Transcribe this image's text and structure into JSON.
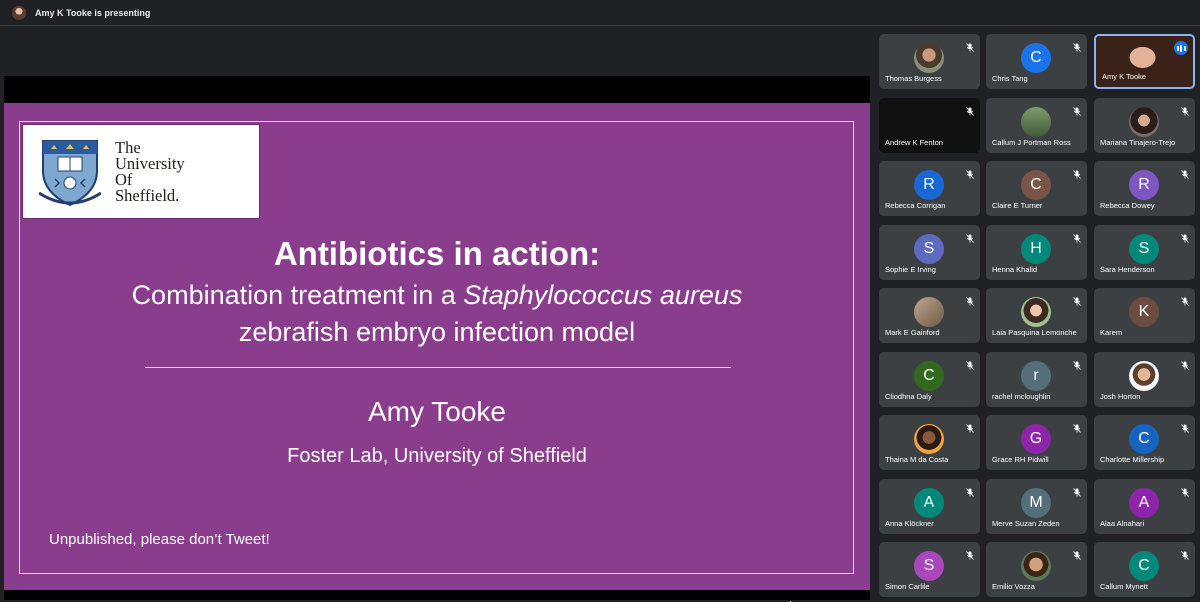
{
  "topbar": {
    "presenting_text": "Amy K Tooke is presenting"
  },
  "slide": {
    "logo_lines": [
      "The",
      "University",
      "Of",
      "Sheffield."
    ],
    "title": "Antibiotics in action:",
    "subtitle_pre": "Combination treatment in a ",
    "subtitle_italic": "Staphylococcus aureus",
    "subtitle_line2": "zebrafish embryo infection model",
    "presenter": "Amy Tooke",
    "affiliation": "Foster Lab, University of Sheffield",
    "disclaimer": "Unpublished, please don’t Tweet!"
  },
  "participants": [
    {
      "name": "Thomas Burgess",
      "type": "photo",
      "muted": true
    },
    {
      "name": "Chris Tang",
      "type": "initial",
      "initial": "C",
      "color": "#1a73e8",
      "muted": true
    },
    {
      "name": "Amy K Tooke",
      "type": "video",
      "speaking": true
    },
    {
      "name": "Andrew K Fenton",
      "type": "dark",
      "muted": true
    },
    {
      "name": "Callum J Portman Ross",
      "type": "photo",
      "muted": true
    },
    {
      "name": "Mariana Tinajero-Trejo",
      "type": "photo",
      "muted": true
    },
    {
      "name": "Rebecca Corrigan",
      "type": "initial",
      "initial": "R",
      "color": "#1967d2",
      "muted": true
    },
    {
      "name": "Claire E Turner",
      "type": "initial",
      "initial": "C",
      "color": "#795548",
      "muted": true
    },
    {
      "name": "Rebecca Dowey",
      "type": "initial",
      "initial": "R",
      "color": "#7e57c2",
      "muted": true
    },
    {
      "name": "Sophie E Irving",
      "type": "initial",
      "initial": "S",
      "color": "#5c6bc0",
      "muted": true
    },
    {
      "name": "Henna Khalid",
      "type": "initial",
      "initial": "H",
      "color": "#00897b",
      "muted": true
    },
    {
      "name": "Sara Henderson",
      "type": "initial",
      "initial": "S",
      "color": "#00897b",
      "muted": true
    },
    {
      "name": "Mark E Gainford",
      "type": "photo",
      "muted": true
    },
    {
      "name": "Laia Pasquina Lemonche",
      "type": "photo",
      "muted": true
    },
    {
      "name": "Karem",
      "type": "initial",
      "initial": "K",
      "color": "#6d4c41",
      "muted": true
    },
    {
      "name": "Cliodhna Daly",
      "type": "initial",
      "initial": "C",
      "color": "#33691e",
      "muted": true
    },
    {
      "name": "rachel mcloughlin",
      "type": "initial",
      "initial": "r",
      "color": "#546e7a",
      "muted": true
    },
    {
      "name": "Josh Horton",
      "type": "photo",
      "muted": true
    },
    {
      "name": "Thaina M da Costa",
      "type": "photo",
      "muted": true
    },
    {
      "name": "Grace RH Pidwill",
      "type": "initial",
      "initial": "G",
      "color": "#8e24aa",
      "muted": true
    },
    {
      "name": "Charlotte Millership",
      "type": "initial",
      "initial": "C",
      "color": "#1565c0",
      "muted": true
    },
    {
      "name": "Anna Klöckner",
      "type": "initial",
      "initial": "A",
      "color": "#00897b",
      "muted": true
    },
    {
      "name": "Merve Suzan Zeden",
      "type": "initial",
      "initial": "M",
      "color": "#546e7a",
      "muted": true
    },
    {
      "name": "Alaa Alnahari",
      "type": "initial",
      "initial": "A",
      "color": "#8e24aa",
      "muted": true
    },
    {
      "name": "Simon Carlile",
      "type": "initial",
      "initial": "S",
      "color": "#ab47bc",
      "muted": true
    },
    {
      "name": "Emilio Vozza",
      "type": "photo",
      "muted": true
    },
    {
      "name": "Callum Mynett",
      "type": "initial",
      "initial": "C",
      "color": "#00897b",
      "muted": true
    }
  ]
}
